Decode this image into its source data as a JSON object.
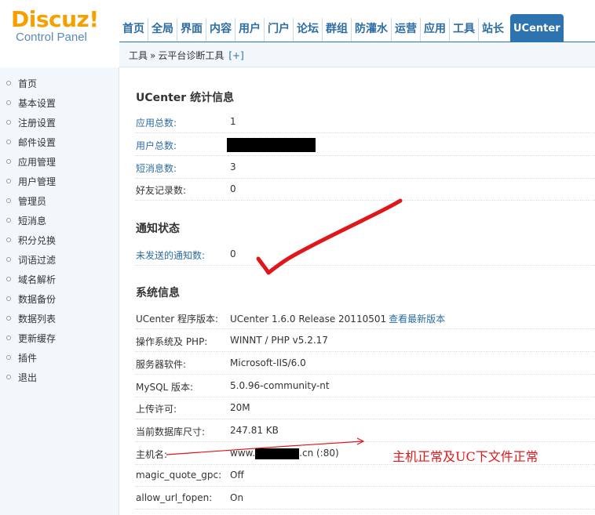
{
  "logo": {
    "main": "Discuz!",
    "sub": "Control Panel"
  },
  "nav": {
    "items": [
      "首页",
      "全局",
      "界面",
      "内容",
      "用户",
      "门户",
      "论坛",
      "群组",
      "防灌水",
      "运营",
      "应用",
      "工具",
      "站长"
    ],
    "active": "UCenter"
  },
  "breadcrumb": {
    "root": "工具",
    "sep": "»",
    "current": "云平台诊断工具",
    "add": "[+]"
  },
  "sidebar": {
    "items": [
      "首页",
      "基本设置",
      "注册设置",
      "邮件设置",
      "应用管理",
      "用户管理",
      "管理员",
      "短消息",
      "积分兑换",
      "词语过滤",
      "域名解析",
      "数据备份",
      "数据列表",
      "更新缓存",
      "插件",
      "退出"
    ]
  },
  "stats": {
    "title": "UCenter 统计信息",
    "rows": [
      {
        "label": "应用总数:",
        "value": "1"
      },
      {
        "label": "用户总数:",
        "value": ""
      },
      {
        "label": "短消息数:",
        "value": "3"
      },
      {
        "label": "好友记录数:",
        "value": "0"
      }
    ]
  },
  "notice": {
    "title": "通知状态",
    "rows": [
      {
        "label": "未发送的通知数:",
        "value": "0"
      }
    ]
  },
  "sysinfo": {
    "title": "系统信息",
    "rows": [
      {
        "label": "UCenter 程序版本:",
        "value": "UCenter 1.6.0 Release 20110501",
        "link": "查看最新版本"
      },
      {
        "label": "操作系统及 PHP:",
        "value": "WINNT / PHP v5.2.17"
      },
      {
        "label": "服务器软件:",
        "value": "Microsoft-IIS/6.0"
      },
      {
        "label": "MySQL 版本:",
        "value": "5.0.96-community-nt"
      },
      {
        "label": "上传许可:",
        "value": "20M"
      },
      {
        "label": "当前数据库尺寸:",
        "value": "247.81 KB"
      },
      {
        "label": "主机名:",
        "value_prefix": "www.",
        "value_suffix": ".cn (:80)"
      },
      {
        "label": "magic_quote_gpc:",
        "value": "Off"
      },
      {
        "label": "allow_url_fopen:",
        "value": "On"
      }
    ]
  },
  "annotation": {
    "note": "主机正常及UC下文件正常"
  },
  "colors": {
    "accent": "#2d73b0",
    "link": "#2d6da3",
    "logo": "#f5a000",
    "annotation": "#e0161a"
  }
}
